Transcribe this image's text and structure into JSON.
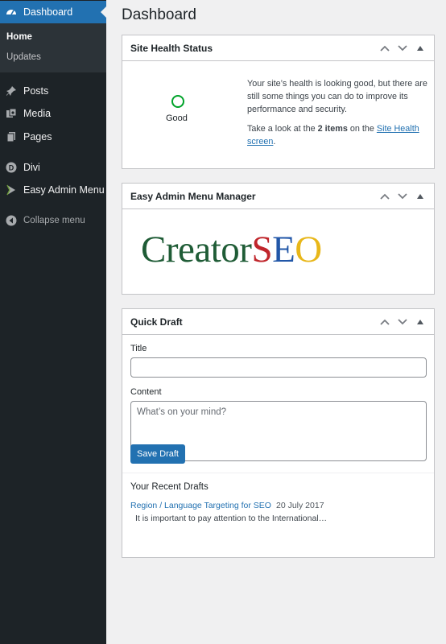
{
  "sidebar": {
    "dashboard": {
      "label": "Dashboard",
      "icon": "dashboard-icon"
    },
    "submenu": {
      "home": "Home",
      "updates": "Updates"
    },
    "items": [
      {
        "label": "Posts",
        "icon": "pin-icon"
      },
      {
        "label": "Media",
        "icon": "media-icon"
      },
      {
        "label": "Pages",
        "icon": "pages-icon"
      },
      {
        "label": "Divi",
        "icon": "divi-icon"
      },
      {
        "label": "Easy Admin Menu",
        "icon": "easy-admin-icon"
      }
    ],
    "collapse": {
      "label": "Collapse menu",
      "icon": "collapse-icon"
    }
  },
  "page": {
    "title": "Dashboard"
  },
  "site_health": {
    "title": "Site Health Status",
    "status": "Good",
    "text1": "Your site’s health is looking good, but there are still some things you can do to improve its performance and security.",
    "text2_prefix": "Take a look at the",
    "text2_bold": "2 items",
    "text2_mid": "on the",
    "link": "Site Health screen",
    "text2_suffix": "."
  },
  "easy_admin": {
    "title": "Easy Admin Menu Manager",
    "logo": {
      "part1": "Creator",
      "s": "S",
      "e": "E",
      "o": "O"
    }
  },
  "quick_draft": {
    "title": "Quick Draft",
    "title_label": "Title",
    "title_value": "",
    "content_label": "Content",
    "content_placeholder": "What’s on your mind?",
    "save_label": "Save Draft",
    "recent_title": "Your Recent Drafts",
    "draft": {
      "link": "Region / Language Targeting for SEO",
      "date": "20 July 2017",
      "excerpt": "It is important to pay attention to the International…"
    }
  },
  "colors": {
    "sidebar_bg": "#1d2327",
    "accent": "#2271b1",
    "health_good": "#00a32a",
    "logo_green": "#1f5c36",
    "logo_red": "#c0262c",
    "logo_blue": "#2257a8",
    "logo_yellow": "#e8b71a"
  }
}
